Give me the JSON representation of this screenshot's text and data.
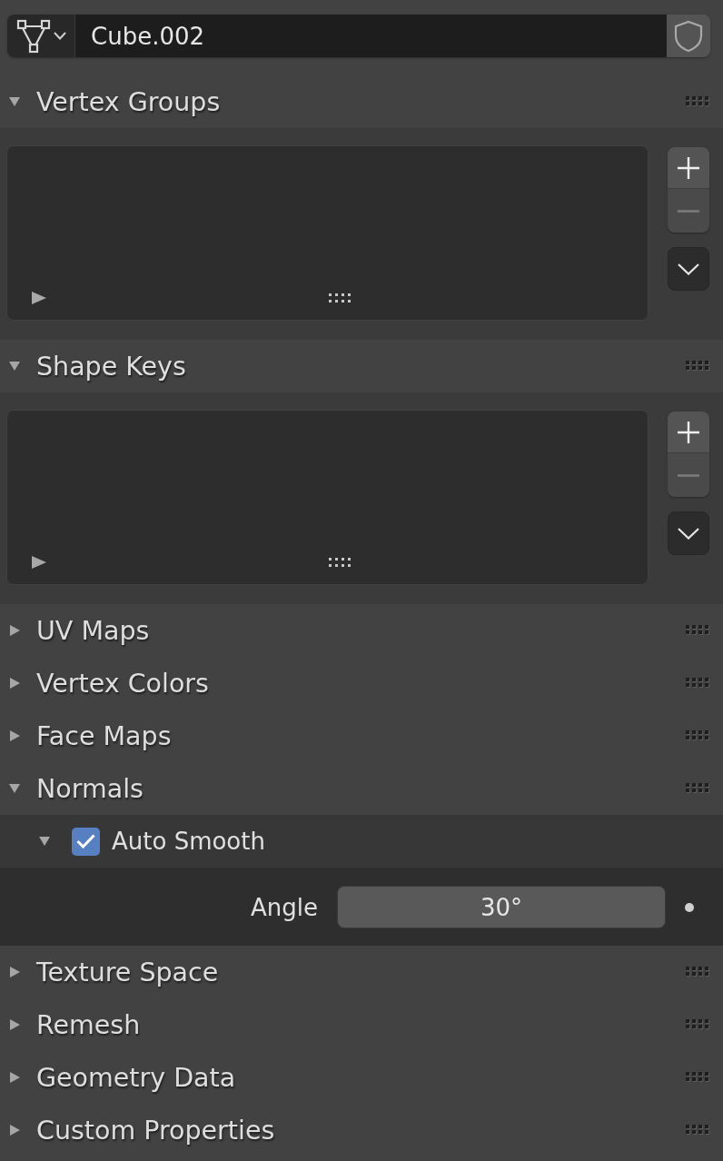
{
  "object_data": {
    "name": "Cube.002"
  },
  "panels": [
    {
      "title": "Vertex Groups",
      "expanded": true,
      "kind": "list",
      "buttons": [
        {
          "kind": "add",
          "disabled": false
        },
        {
          "kind": "remove",
          "disabled": true
        }
      ]
    },
    {
      "title": "Shape Keys",
      "expanded": true,
      "kind": "list",
      "buttons": [
        {
          "kind": "add",
          "disabled": false
        },
        {
          "kind": "remove",
          "disabled": true
        }
      ]
    },
    {
      "title": "UV Maps",
      "expanded": false
    },
    {
      "title": "Vertex Colors",
      "expanded": false
    },
    {
      "title": "Face Maps",
      "expanded": false
    },
    {
      "title": "Normals",
      "expanded": true,
      "kind": "subpanel",
      "subpanel": {
        "label": "Auto Smooth",
        "expanded": true,
        "checked": true,
        "fields": [
          {
            "label": "Angle",
            "value": "30°"
          }
        ]
      }
    },
    {
      "title": "Texture Space",
      "expanded": false
    },
    {
      "title": "Remesh",
      "expanded": false
    },
    {
      "title": "Geometry Data",
      "expanded": false
    },
    {
      "title": "Custom Properties",
      "expanded": false
    }
  ]
}
